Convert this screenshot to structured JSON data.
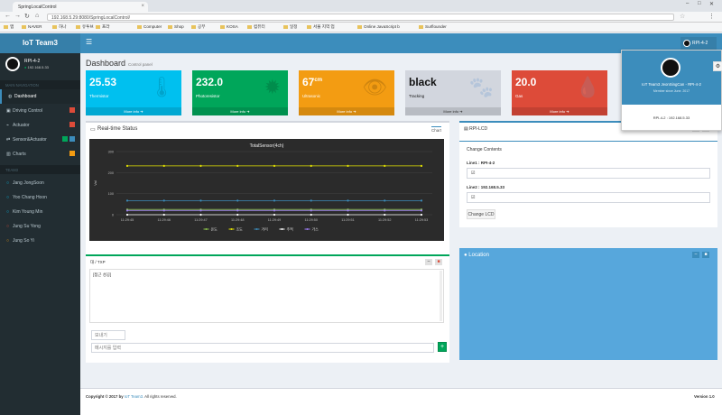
{
  "browser": {
    "tab_title": "SpringLocalControl",
    "url": "192.168.5.29:8080/SpringLocalControl/",
    "bookmarks": [
      "앱",
      "NAVER",
      "하나",
      "유투브",
      "프라",
      "Computer",
      "Shop",
      "공부",
      "KOSA",
      "컴퓨터",
      "일정",
      "서울 지역 업",
      "Online JavaScript b",
      "Surflounder"
    ]
  },
  "app": {
    "logo": "IoT Team3",
    "user_short": "RPI-4-2"
  },
  "sidebar": {
    "user_name": "RPI-4-2",
    "user_status": "192.168.5.33",
    "header_main": "MAIN NAVIGATION",
    "items": [
      {
        "label": "Dashboard",
        "active": true,
        "badge": ""
      },
      {
        "label": "Driving Control",
        "badge": "",
        "badge_color": "#dd4b39"
      },
      {
        "label": "Actuator",
        "badge": "",
        "badge_color": "#dd4b39"
      },
      {
        "label": "Sensor&Actuator",
        "badge": "",
        "badge_color": "#3c8dbc"
      },
      {
        "label": "Charts",
        "badge": "",
        "badge_color": "#f39c12"
      }
    ],
    "header_team": "TEAM3",
    "team": [
      "Jang JongSoon",
      "Yoo Chang Hoon",
      "Kim Young Min",
      "Jung Su Yong",
      "Jung So Yi"
    ],
    "team_colors": [
      "#00c0ef",
      "#00c0ef",
      "#00c0ef",
      "#dd4b39",
      "#f39c12"
    ]
  },
  "page": {
    "title": "Dashboard",
    "subtitle": "Control panel"
  },
  "info_boxes": [
    {
      "value": "25.53",
      "unit": "",
      "label": "Thermistor",
      "color": "#00c0ef",
      "icon": "thermometer-icon",
      "glyph": "🌡",
      "footer": "More info"
    },
    {
      "value": "232.0",
      "unit": "",
      "label": "Photoresistor",
      "color": "#00a65a",
      "icon": "sun-icon",
      "glyph": "✹",
      "footer": "More info"
    },
    {
      "value": "67",
      "unit": "cm",
      "label": "Ultrasonic",
      "color": "#f39c12",
      "icon": "eye-icon",
      "glyph": "👁",
      "footer": "More info"
    },
    {
      "value": "black",
      "unit": "",
      "label": "Tracking",
      "color": "#d2d6de",
      "icon": "paw-icon",
      "glyph": "🐾",
      "footer": "More info"
    },
    {
      "value": "20.0",
      "unit": "",
      "label": "Gas",
      "color": "#dd4b39",
      "icon": "drop-icon",
      "glyph": "💧",
      "footer": "More info"
    }
  ],
  "popup": {
    "name": "IoT Team3 JeonSingCan - RPI-4-2",
    "since": "Member since June. 2017",
    "ip": "RPI-4-2 : 192.168.5.33"
  },
  "realtime": {
    "title": "Real-time Status",
    "tab": "Chart"
  },
  "chart_data": {
    "type": "line",
    "title": "TotalSensor(4ch)",
    "categories": [
      "11:29:45",
      "11:29:46",
      "11:29:47",
      "11:29:48",
      "11:29:49",
      "11:29:50",
      "11:29:51",
      "11:29:52",
      "11:29:53"
    ],
    "ylabel": "Val",
    "yticks": [
      "0",
      "100",
      "200",
      "300"
    ],
    "ylim": [
      0,
      300
    ],
    "series": [
      {
        "name": "온도",
        "color": "#8bc34a",
        "values": [
          25,
          25,
          25,
          25,
          25,
          25,
          25,
          25,
          25
        ]
      },
      {
        "name": "조도",
        "color": "#e6e600",
        "values": [
          232,
          232,
          232,
          232,
          232,
          232,
          232,
          232,
          232
        ]
      },
      {
        "name": "거리",
        "color": "#3c8dbc",
        "values": [
          67,
          67,
          67,
          67,
          67,
          67,
          67,
          67,
          67
        ]
      },
      {
        "name": "추적",
        "color": "#ffffff",
        "values": [
          0,
          0,
          0,
          0,
          0,
          0,
          0,
          0,
          0
        ]
      },
      {
        "name": "가스",
        "color": "#9c7cf4",
        "values": [
          20,
          20,
          20,
          20,
          20,
          20,
          20,
          20,
          20
        ]
      }
    ]
  },
  "lcd": {
    "title": "RPI-LCD",
    "section": "Change Contents",
    "line1_label": "Line1 : RPI-4-2",
    "line1_value": "☑",
    "line2_label": "Line2 : 192.168.5.33",
    "line2_value": "☑",
    "button": "Change LCD"
  },
  "chat": {
    "title": "대 / TXP",
    "body": "[접근 성공]",
    "send_placeholder": "보내기",
    "input_placeholder": "메시지를 입력",
    "send_button": "+"
  },
  "location": {
    "title": "Location"
  },
  "footer": {
    "copyright_prefix": "Copyright © 2017 by ",
    "team": "IoT Team3.",
    "rights": " All rights reserved.",
    "version": "Version 1.0"
  }
}
